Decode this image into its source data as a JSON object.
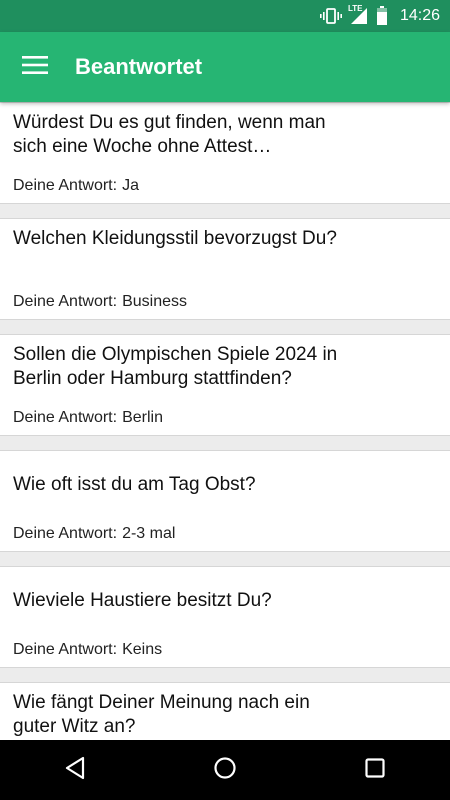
{
  "status_bar": {
    "time": "14:26",
    "network_label": "LTE",
    "icons": [
      "vibrate-icon",
      "signal-icon",
      "battery-icon"
    ]
  },
  "app_bar": {
    "title": "Beantwortet",
    "menu_icon": "hamburger-menu-icon",
    "background_color": "#26b573",
    "status_color": "#1f8f5e"
  },
  "answer_prefix": "Deine Antwort:",
  "items": [
    {
      "question": "Würdest Du es gut finden, wenn man sich eine Woche ohne Attest…",
      "answer": "Ja"
    },
    {
      "question": "Welchen Kleidungsstil bevorzugst Du?",
      "answer": "Business"
    },
    {
      "question": "Sollen die Olympischen Spiele 2024 in Berlin oder Hamburg stattfinden?",
      "answer": "Berlin"
    },
    {
      "question": "Wie oft isst du am Tag Obst?",
      "answer": "2-3 mal"
    },
    {
      "question": "Wieviele Haustiere besitzt Du?",
      "answer": "Keins"
    },
    {
      "question": "Wie fängt Deiner Meinung nach ein guter Witz an?",
      "answer": ""
    }
  ],
  "nav_bar": {
    "icons": [
      "back-icon",
      "home-icon",
      "recents-icon"
    ]
  }
}
